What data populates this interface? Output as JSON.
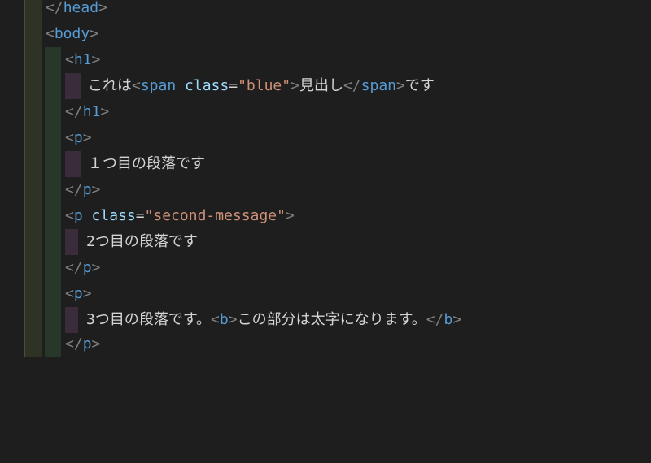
{
  "theme": {
    "background": "#1e1e1e",
    "tag_color": "#569cd6",
    "punct_color": "#808080",
    "attr_color": "#9cdcfe",
    "string_color": "#ce9178",
    "text_color": "#d4d4d4"
  },
  "code": {
    "l1": {
      "p1": "</",
      "tag": "head",
      "p2": ">"
    },
    "l2": {
      "p1": "<",
      "tag": "body",
      "p2": ">"
    },
    "l3": {
      "p1": "<",
      "tag": "h1",
      "p2": ">"
    },
    "l4": {
      "t1": "これは",
      "p1": "<",
      "tag": "span",
      "attr": "class",
      "eq": "=",
      "val": "\"blue\"",
      "p2": ">",
      "t2": "見出し",
      "p3": "</",
      "tag2": "span",
      "p4": ">",
      "t3": "です"
    },
    "l5": {
      "p1": "</",
      "tag": "h1",
      "p2": ">"
    },
    "l6": {
      "p1": "<",
      "tag": "p",
      "p2": ">"
    },
    "l7": {
      "t1": "１つ目の段落です"
    },
    "l8": {
      "p1": "</",
      "tag": "p",
      "p2": ">"
    },
    "l9": {
      "p1": "<",
      "tag": "p",
      "attr": "class",
      "eq": "=",
      "val": "\"second-message\"",
      "p2": ">"
    },
    "l10": {
      "t1": "2つ目の段落です"
    },
    "l11": {
      "p1": "</",
      "tag": "p",
      "p2": ">"
    },
    "l12": {
      "p1": "<",
      "tag": "p",
      "p2": ">"
    },
    "l13": {
      "t1": "3つ目の段落です。",
      "p1": "<",
      "tag": "b",
      "p2": ">",
      "t2": "この部分は太字になります。",
      "p3": "</",
      "tag2": "b",
      "p4": ">"
    },
    "l14": {
      "p1": "</",
      "tag": "p",
      "p2": ">"
    }
  }
}
